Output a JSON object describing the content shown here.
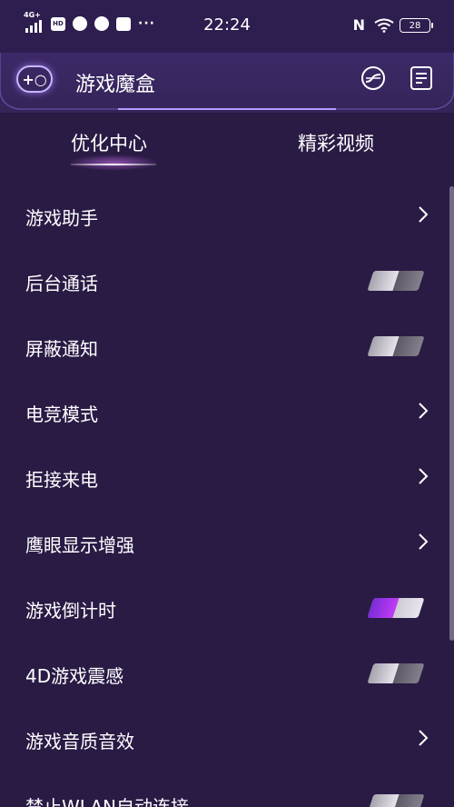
{
  "status_bar": {
    "network": "4G+",
    "hd_badge": "HD",
    "time": "22:24",
    "nfc": "N",
    "battery": "28",
    "more": "···"
  },
  "header": {
    "logo_text": "+○",
    "title": "游戏魔盒"
  },
  "tabs": [
    {
      "label": "优化中心",
      "active": true
    },
    {
      "label": "精彩视频",
      "active": false
    }
  ],
  "settings": [
    {
      "label": "游戏助手",
      "control": "chevron"
    },
    {
      "label": "后台通话",
      "control": "toggle",
      "on": false
    },
    {
      "label": "屏蔽通知",
      "control": "toggle",
      "on": false
    },
    {
      "label": "电竞模式",
      "control": "chevron"
    },
    {
      "label": "拒接来电",
      "control": "chevron"
    },
    {
      "label": "鹰眼显示增强",
      "control": "chevron"
    },
    {
      "label": "游戏倒计时",
      "control": "toggle",
      "on": true
    },
    {
      "label": "4D游戏震感",
      "control": "toggle",
      "on": false
    },
    {
      "label": "游戏音质音效",
      "control": "chevron"
    },
    {
      "label": "禁止WLAN自动连接",
      "control": "toggle",
      "on": false
    }
  ],
  "colors": {
    "background": "#2a1b45",
    "header": "#3c2968",
    "toggle_on": "#a83cf0",
    "accent_glow": "#c7b8ff"
  },
  "icons": {
    "header_right_1": "performance-curve-icon",
    "header_right_2": "notes-icon"
  }
}
